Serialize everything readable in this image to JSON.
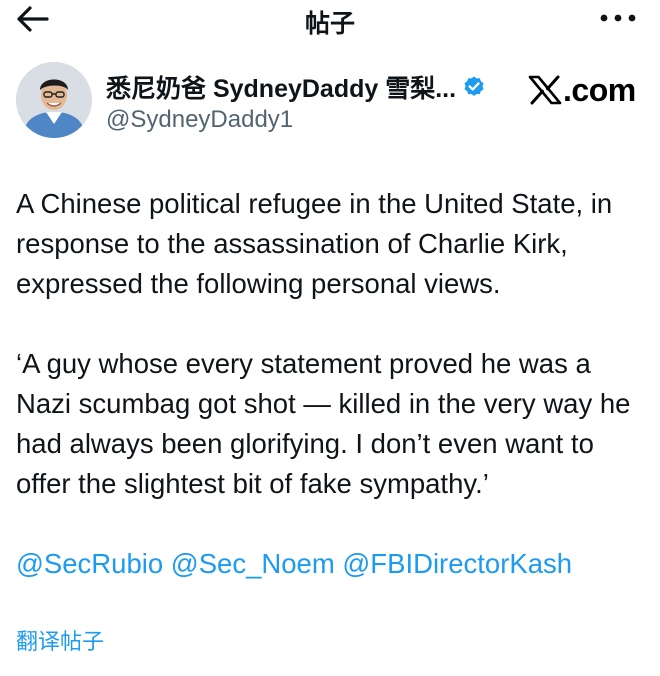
{
  "header": {
    "title": "帖子",
    "back_icon": "arrow-left-icon",
    "more_icon": "more-horizontal-icon"
  },
  "post": {
    "author": {
      "display_name": "悉尼奶爸 SydneyDaddy 雪梨...",
      "handle": "@SydneyDaddy1",
      "verified": true
    },
    "brand": {
      "label": ".com",
      "x_mark": "X"
    },
    "paragraph1": "A Chinese political refugee in the United State, in response to the assassination of Charlie Kirk, expressed the following personal views.",
    "paragraph2": "‘A guy whose every statement proved he was a Nazi scumbag got shot — killed in the very way he had always been glorifying. I don’t even want to offer the slightest bit of fake sympathy.’",
    "mentions": [
      "@SecRubio",
      "@Sec_Noem",
      "@FBIDirectorKash"
    ],
    "translate_label": "翻译帖子"
  },
  "colors": {
    "text": "#0f1419",
    "secondary": "#536471",
    "link": "#1d9bf0"
  }
}
